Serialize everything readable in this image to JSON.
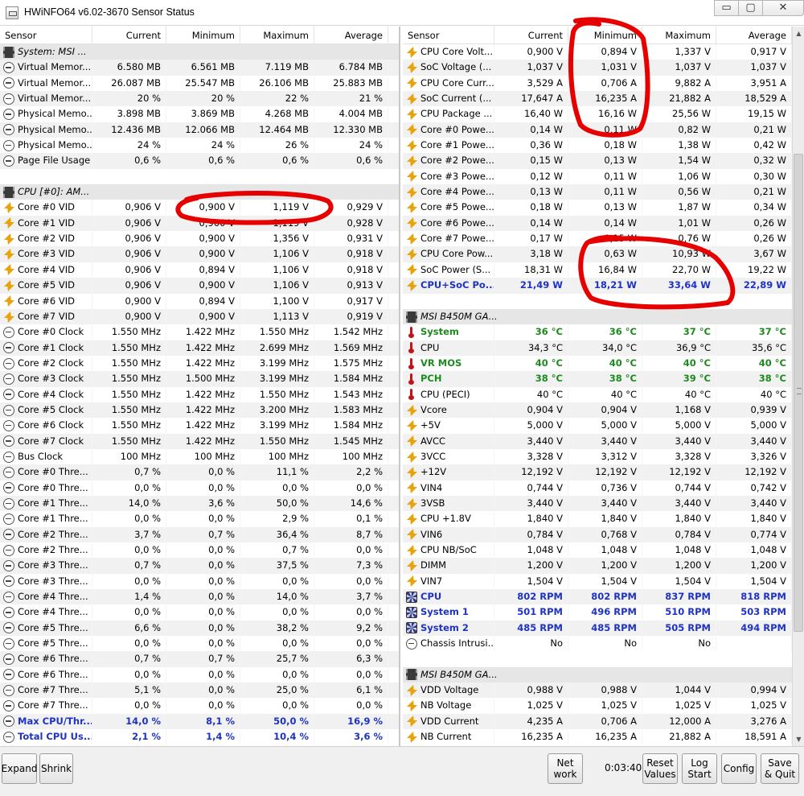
{
  "window": {
    "title": "HWiNFO64 v6.02-3670 Sensor Status",
    "controls": {
      "minimize": "▭",
      "maximize": "▢",
      "close": "✕"
    }
  },
  "columns": [
    "Sensor",
    "Current",
    "Minimum",
    "Maximum",
    "Average"
  ],
  "left_rows": [
    {
      "type": "group",
      "label": "System: MSI ...",
      "icon": "chip-icon"
    },
    {
      "label": "Virtual Memor...",
      "icon": "clock-icon",
      "v": [
        "6.580 MB",
        "6.561 MB",
        "7.119 MB",
        "6.784 MB"
      ]
    },
    {
      "label": "Virtual Memor...",
      "icon": "clock-icon",
      "v": [
        "26.087 MB",
        "25.547 MB",
        "26.106 MB",
        "25.883 MB"
      ]
    },
    {
      "label": "Virtual Memor...",
      "icon": "clock-icon",
      "v": [
        "20 %",
        "20 %",
        "22 %",
        "21 %"
      ]
    },
    {
      "label": "Physical Memo...",
      "icon": "clock-icon",
      "v": [
        "3.898 MB",
        "3.869 MB",
        "4.268 MB",
        "4.004 MB"
      ]
    },
    {
      "label": "Physical Memo...",
      "icon": "clock-icon",
      "v": [
        "12.436 MB",
        "12.066 MB",
        "12.464 MB",
        "12.330 MB"
      ]
    },
    {
      "label": "Physical Memo...",
      "icon": "clock-icon",
      "v": [
        "24 %",
        "24 %",
        "26 %",
        "24 %"
      ]
    },
    {
      "label": "Page File Usage",
      "icon": "clock-icon",
      "v": [
        "0,6 %",
        "0,6 %",
        "0,6 %",
        "0,6 %"
      ]
    },
    {
      "type": "blank"
    },
    {
      "type": "group",
      "label": "CPU [#0]: AM...",
      "icon": "chip-icon"
    },
    {
      "label": "Core #0 VID",
      "icon": "bolt-icon",
      "v": [
        "0,906 V",
        "0,900 V",
        "1,119 V",
        "0,929 V"
      ]
    },
    {
      "label": "Core #1 VID",
      "icon": "bolt-icon",
      "v": [
        "0,906 V",
        "0,900 V",
        "1,119 V",
        "0,928 V"
      ]
    },
    {
      "label": "Core #2 VID",
      "icon": "bolt-icon",
      "v": [
        "0,906 V",
        "0,900 V",
        "1,356 V",
        "0,931 V"
      ]
    },
    {
      "label": "Core #3 VID",
      "icon": "bolt-icon",
      "v": [
        "0,906 V",
        "0,900 V",
        "1,106 V",
        "0,918 V"
      ]
    },
    {
      "label": "Core #4 VID",
      "icon": "bolt-icon",
      "v": [
        "0,906 V",
        "0,894 V",
        "1,106 V",
        "0,918 V"
      ]
    },
    {
      "label": "Core #5 VID",
      "icon": "bolt-icon",
      "v": [
        "0,906 V",
        "0,900 V",
        "1,106 V",
        "0,913 V"
      ]
    },
    {
      "label": "Core #6 VID",
      "icon": "bolt-icon",
      "v": [
        "0,900 V",
        "0,894 V",
        "1,100 V",
        "0,917 V"
      ]
    },
    {
      "label": "Core #7 VID",
      "icon": "bolt-icon",
      "v": [
        "0,900 V",
        "0,900 V",
        "1,113 V",
        "0,919 V"
      ]
    },
    {
      "label": "Core #0 Clock",
      "icon": "clock-icon",
      "v": [
        "1.550 MHz",
        "1.422 MHz",
        "1.550 MHz",
        "1.542 MHz"
      ]
    },
    {
      "label": "Core #1 Clock",
      "icon": "clock-icon",
      "v": [
        "1.550 MHz",
        "1.422 MHz",
        "2.699 MHz",
        "1.569 MHz"
      ]
    },
    {
      "label": "Core #2 Clock",
      "icon": "clock-icon",
      "v": [
        "1.550 MHz",
        "1.422 MHz",
        "3.199 MHz",
        "1.575 MHz"
      ]
    },
    {
      "label": "Core #3 Clock",
      "icon": "clock-icon",
      "v": [
        "1.550 MHz",
        "1.500 MHz",
        "3.199 MHz",
        "1.584 MHz"
      ]
    },
    {
      "label": "Core #4 Clock",
      "icon": "clock-icon",
      "v": [
        "1.550 MHz",
        "1.422 MHz",
        "1.550 MHz",
        "1.543 MHz"
      ]
    },
    {
      "label": "Core #5 Clock",
      "icon": "clock-icon",
      "v": [
        "1.550 MHz",
        "1.422 MHz",
        "3.200 MHz",
        "1.583 MHz"
      ]
    },
    {
      "label": "Core #6 Clock",
      "icon": "clock-icon",
      "v": [
        "1.550 MHz",
        "1.422 MHz",
        "3.199 MHz",
        "1.584 MHz"
      ]
    },
    {
      "label": "Core #7 Clock",
      "icon": "clock-icon",
      "v": [
        "1.550 MHz",
        "1.422 MHz",
        "1.550 MHz",
        "1.545 MHz"
      ]
    },
    {
      "label": "Bus Clock",
      "icon": "clock-icon",
      "v": [
        "100 MHz",
        "100 MHz",
        "100 MHz",
        "100 MHz"
      ]
    },
    {
      "label": "Core #0 Thre...",
      "icon": "clock-icon",
      "v": [
        "0,7 %",
        "0,0 %",
        "11,1 %",
        "2,2 %"
      ]
    },
    {
      "label": "Core #0 Thre...",
      "icon": "clock-icon",
      "v": [
        "0,0 %",
        "0,0 %",
        "0,0 %",
        "0,0 %"
      ]
    },
    {
      "label": "Core #1 Thre...",
      "icon": "clock-icon",
      "v": [
        "14,0 %",
        "3,6 %",
        "50,0 %",
        "14,6 %"
      ]
    },
    {
      "label": "Core #1 Thre...",
      "icon": "clock-icon",
      "v": [
        "0,0 %",
        "0,0 %",
        "2,9 %",
        "0,1 %"
      ]
    },
    {
      "label": "Core #2 Thre...",
      "icon": "clock-icon",
      "v": [
        "3,7 %",
        "0,7 %",
        "36,4 %",
        "8,7 %"
      ]
    },
    {
      "label": "Core #2 Thre...",
      "icon": "clock-icon",
      "v": [
        "0,0 %",
        "0,0 %",
        "0,7 %",
        "0,0 %"
      ]
    },
    {
      "label": "Core #3 Thre...",
      "icon": "clock-icon",
      "v": [
        "0,7 %",
        "0,0 %",
        "37,5 %",
        "7,3 %"
      ]
    },
    {
      "label": "Core #3 Thre...",
      "icon": "clock-icon",
      "v": [
        "0,0 %",
        "0,0 %",
        "0,0 %",
        "0,0 %"
      ]
    },
    {
      "label": "Core #4 Thre...",
      "icon": "clock-icon",
      "v": [
        "1,4 %",
        "0,0 %",
        "14,0 %",
        "3,7 %"
      ]
    },
    {
      "label": "Core #4 Thre...",
      "icon": "clock-icon",
      "v": [
        "0,0 %",
        "0,0 %",
        "0,0 %",
        "0,0 %"
      ]
    },
    {
      "label": "Core #5 Thre...",
      "icon": "clock-icon",
      "v": [
        "6,6 %",
        "0,0 %",
        "38,2 %",
        "9,2 %"
      ]
    },
    {
      "label": "Core #5 Thre...",
      "icon": "clock-icon",
      "v": [
        "0,0 %",
        "0,0 %",
        "0,0 %",
        "0,0 %"
      ]
    },
    {
      "label": "Core #6 Thre...",
      "icon": "clock-icon",
      "v": [
        "0,7 %",
        "0,7 %",
        "25,7 %",
        "6,3 %"
      ]
    },
    {
      "label": "Core #6 Thre...",
      "icon": "clock-icon",
      "v": [
        "0,0 %",
        "0,0 %",
        "0,0 %",
        "0,0 %"
      ]
    },
    {
      "label": "Core #7 Thre...",
      "icon": "clock-icon",
      "v": [
        "5,1 %",
        "0,0 %",
        "25,0 %",
        "6,1 %"
      ]
    },
    {
      "label": "Core #7 Thre...",
      "icon": "clock-icon",
      "v": [
        "0,0 %",
        "0,0 %",
        "0,0 %",
        "0,0 %"
      ]
    },
    {
      "label": "Max CPU/Thr...",
      "icon": "clock-icon",
      "style": "bold-blue",
      "v": [
        "14,0 %",
        "8,1 %",
        "50,0 %",
        "16,9 %"
      ]
    },
    {
      "label": "Total CPU Us...",
      "icon": "clock-icon",
      "style": "bold-blue",
      "v": [
        "2,1 %",
        "1,4 %",
        "10,4 %",
        "3,6 %"
      ]
    }
  ],
  "right_rows": [
    {
      "label": "CPU Core Volt...",
      "icon": "bolt-icon",
      "v": [
        "0,900 V",
        "0,894 V",
        "1,337 V",
        "0,917 V"
      ]
    },
    {
      "label": "SoC Voltage (...",
      "icon": "bolt-icon",
      "v": [
        "1,037 V",
        "1,031 V",
        "1,037 V",
        "1,037 V"
      ]
    },
    {
      "label": "CPU Core Curr...",
      "icon": "bolt-icon",
      "v": [
        "3,529 A",
        "0,706 A",
        "9,882 A",
        "3,951 A"
      ]
    },
    {
      "label": "SoC Current (...",
      "icon": "bolt-icon",
      "v": [
        "17,647 A",
        "16,235 A",
        "21,882 A",
        "18,529 A"
      ]
    },
    {
      "label": "CPU Package ...",
      "icon": "bolt-icon",
      "v": [
        "16,40 W",
        "16,16 W",
        "25,56 W",
        "19,15 W"
      ]
    },
    {
      "label": "Core #0 Powe...",
      "icon": "bolt-icon",
      "v": [
        "0,14 W",
        "0,11 W",
        "0,82 W",
        "0,21 W"
      ]
    },
    {
      "label": "Core #1 Powe...",
      "icon": "bolt-icon",
      "v": [
        "0,36 W",
        "0,18 W",
        "1,38 W",
        "0,42 W"
      ]
    },
    {
      "label": "Core #2 Powe...",
      "icon": "bolt-icon",
      "v": [
        "0,15 W",
        "0,13 W",
        "1,54 W",
        "0,32 W"
      ]
    },
    {
      "label": "Core #3 Powe...",
      "icon": "bolt-icon",
      "v": [
        "0,12 W",
        "0,11 W",
        "1,06 W",
        "0,30 W"
      ]
    },
    {
      "label": "Core #4 Powe...",
      "icon": "bolt-icon",
      "v": [
        "0,13 W",
        "0,11 W",
        "0,56 W",
        "0,21 W"
      ]
    },
    {
      "label": "Core #5 Powe...",
      "icon": "bolt-icon",
      "v": [
        "0,18 W",
        "0,13 W",
        "1,87 W",
        "0,34 W"
      ]
    },
    {
      "label": "Core #6 Powe...",
      "icon": "bolt-icon",
      "v": [
        "0,14 W",
        "0,14 W",
        "1,01 W",
        "0,26 W"
      ]
    },
    {
      "label": "Core #7 Powe...",
      "icon": "bolt-icon",
      "v": [
        "0,17 W",
        "0,15 W",
        "0,76 W",
        "0,26 W"
      ]
    },
    {
      "label": "CPU Core Pow...",
      "icon": "bolt-icon",
      "v": [
        "3,18 W",
        "0,63 W",
        "10,93 W",
        "3,67 W"
      ]
    },
    {
      "label": "SoC Power (S...",
      "icon": "bolt-icon",
      "v": [
        "18,31 W",
        "16,84 W",
        "22,70 W",
        "19,22 W"
      ]
    },
    {
      "label": "CPU+SoC Po...",
      "icon": "bolt-icon",
      "style": "bold-blue",
      "v": [
        "21,49 W",
        "18,21 W",
        "33,64 W",
        "22,89 W"
      ]
    },
    {
      "type": "blank"
    },
    {
      "type": "group",
      "label": "MSI B450M GA...",
      "icon": "chip-icon"
    },
    {
      "label": "System",
      "icon": "thermometer-icon",
      "style": "bold-green",
      "v": [
        "36 °C",
        "36 °C",
        "37 °C",
        "37 °C"
      ]
    },
    {
      "label": "CPU",
      "icon": "thermometer-icon",
      "v": [
        "34,3 °C",
        "34,0 °C",
        "36,9 °C",
        "35,6 °C"
      ]
    },
    {
      "label": "VR MOS",
      "icon": "thermometer-icon",
      "style": "bold-green",
      "v": [
        "40 °C",
        "40 °C",
        "40 °C",
        "40 °C"
      ]
    },
    {
      "label": "PCH",
      "icon": "thermometer-icon",
      "style": "bold-green",
      "v": [
        "38 °C",
        "38 °C",
        "39 °C",
        "38 °C"
      ]
    },
    {
      "label": "CPU (PECI)",
      "icon": "thermometer-icon",
      "v": [
        "40 °C",
        "40 °C",
        "40 °C",
        "40 °C"
      ]
    },
    {
      "label": "Vcore",
      "icon": "bolt-icon",
      "v": [
        "0,904 V",
        "0,904 V",
        "1,168 V",
        "0,939 V"
      ]
    },
    {
      "label": "+5V",
      "icon": "bolt-icon",
      "v": [
        "5,000 V",
        "5,000 V",
        "5,000 V",
        "5,000 V"
      ]
    },
    {
      "label": "AVCC",
      "icon": "bolt-icon",
      "v": [
        "3,440 V",
        "3,440 V",
        "3,440 V",
        "3,440 V"
      ]
    },
    {
      "label": "3VCC",
      "icon": "bolt-icon",
      "v": [
        "3,328 V",
        "3,312 V",
        "3,328 V",
        "3,326 V"
      ]
    },
    {
      "label": "+12V",
      "icon": "bolt-icon",
      "v": [
        "12,192 V",
        "12,192 V",
        "12,192 V",
        "12,192 V"
      ]
    },
    {
      "label": "VIN4",
      "icon": "bolt-icon",
      "v": [
        "0,744 V",
        "0,736 V",
        "0,744 V",
        "0,742 V"
      ]
    },
    {
      "label": "3VSB",
      "icon": "bolt-icon",
      "v": [
        "3,440 V",
        "3,440 V",
        "3,440 V",
        "3,440 V"
      ]
    },
    {
      "label": "CPU +1.8V",
      "icon": "bolt-icon",
      "v": [
        "1,840 V",
        "1,840 V",
        "1,840 V",
        "1,840 V"
      ]
    },
    {
      "label": "VIN6",
      "icon": "bolt-icon",
      "v": [
        "0,784 V",
        "0,768 V",
        "0,784 V",
        "0,774 V"
      ]
    },
    {
      "label": "CPU NB/SoC",
      "icon": "bolt-icon",
      "v": [
        "1,048 V",
        "1,048 V",
        "1,048 V",
        "1,048 V"
      ]
    },
    {
      "label": "DIMM",
      "icon": "bolt-icon",
      "v": [
        "1,200 V",
        "1,200 V",
        "1,200 V",
        "1,200 V"
      ]
    },
    {
      "label": "VIN7",
      "icon": "bolt-icon",
      "v": [
        "1,504 V",
        "1,504 V",
        "1,504 V",
        "1,504 V"
      ]
    },
    {
      "label": "CPU",
      "icon": "fan-icon",
      "style": "bold-blue",
      "v": [
        "802 RPM",
        "802 RPM",
        "837 RPM",
        "818 RPM"
      ]
    },
    {
      "label": "System 1",
      "icon": "fan-icon",
      "style": "bold-blue",
      "v": [
        "501 RPM",
        "496 RPM",
        "510 RPM",
        "503 RPM"
      ]
    },
    {
      "label": "System 2",
      "icon": "fan-icon",
      "style": "bold-blue",
      "v": [
        "485 RPM",
        "485 RPM",
        "505 RPM",
        "494 RPM"
      ]
    },
    {
      "label": "Chassis Intrusi...",
      "icon": "clock-icon",
      "v": [
        "No",
        "No",
        "No",
        ""
      ]
    },
    {
      "type": "blank"
    },
    {
      "type": "group",
      "label": "MSI B450M GA...",
      "icon": "chip-icon"
    },
    {
      "label": "VDD Voltage",
      "icon": "bolt-icon",
      "v": [
        "0,988 V",
        "0,988 V",
        "1,044 V",
        "0,994 V"
      ]
    },
    {
      "label": "NB Voltage",
      "icon": "bolt-icon",
      "v": [
        "1,025 V",
        "1,025 V",
        "1,025 V",
        "1,025 V"
      ]
    },
    {
      "label": "VDD Current",
      "icon": "bolt-icon",
      "v": [
        "4,235 A",
        "0,706 A",
        "12,000 A",
        "3,276 A"
      ]
    },
    {
      "label": "NB Current",
      "icon": "bolt-icon",
      "v": [
        "16,235 A",
        "16,235 A",
        "21,882 A",
        "18,591 A"
      ]
    }
  ],
  "bottom": {
    "expand": "Expand",
    "shrink": "Shrink",
    "network": "Net work",
    "elapsed": "0:03:40",
    "reset_values": "Reset Values",
    "log_start": "Log Start",
    "config": "Config",
    "save_quit": "Save & Quit"
  },
  "colors": {
    "highlight_green": "#1d8a1d",
    "highlight_blue": "#1f33c2",
    "annotation_red": "#e60000"
  }
}
